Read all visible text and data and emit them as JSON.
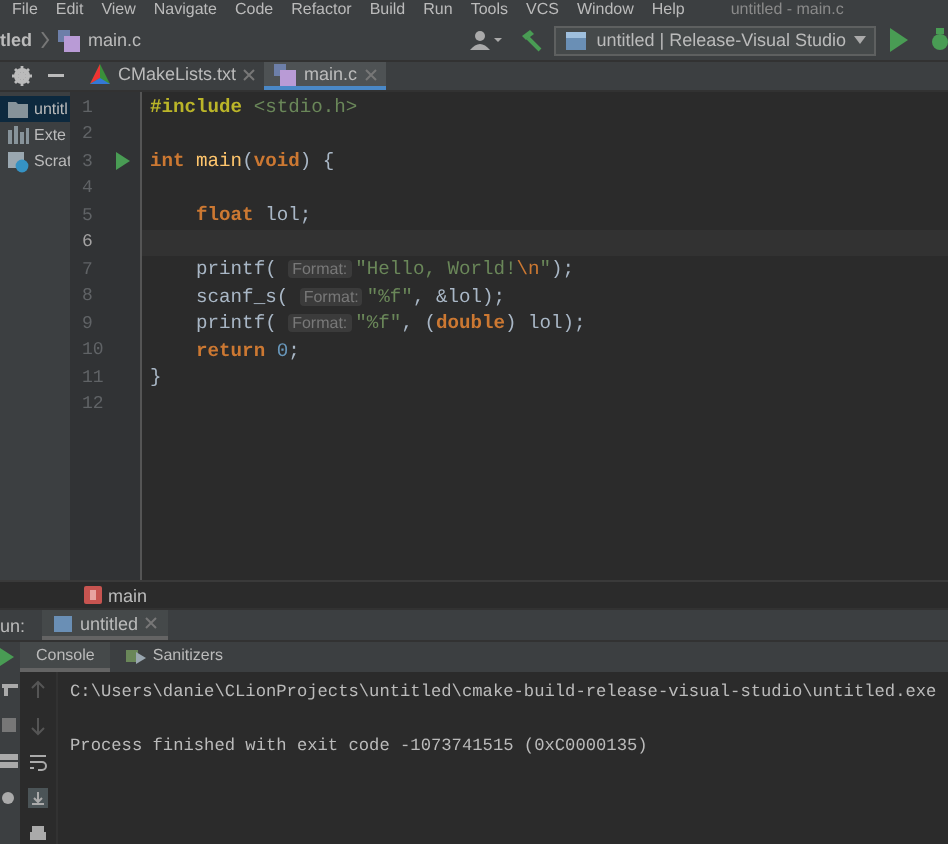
{
  "menu": [
    "File",
    "Edit",
    "View",
    "Navigate",
    "Code",
    "Refactor",
    "Build",
    "Run",
    "Tools",
    "VCS",
    "Window",
    "Help"
  ],
  "window_title": "untitled - main.c",
  "breadcrumbs": [
    "tled",
    "main.c"
  ],
  "run_config": "untitled | Release-Visual Studio",
  "editor_tabs": [
    {
      "label": "CMakeLists.txt",
      "kind": "cmake",
      "selected": false
    },
    {
      "label": "main.c",
      "kind": "c",
      "selected": true
    }
  ],
  "project_tree": [
    {
      "label": "untitl",
      "kind": "folder",
      "selected": true
    },
    {
      "label": "Exte",
      "kind": "library",
      "selected": false
    },
    {
      "label": "Scrat",
      "kind": "scratch",
      "selected": false
    }
  ],
  "code": [
    {
      "number": "1",
      "current": false,
      "run_marker": false,
      "tokens": [
        {
          "kind": "directive",
          "text": "#include"
        },
        {
          "kind": "header",
          "text": " <stdio.h>"
        }
      ]
    },
    {
      "number": "2",
      "current": false,
      "run_marker": false
    },
    {
      "number": "3",
      "current": false,
      "run_marker": true,
      "tokens": [
        {
          "kind": "keyword",
          "text": "int"
        },
        {
          "kind": "function",
          "text": " main"
        },
        {
          "kind": "plain",
          "text": "("
        },
        {
          "kind": "keyword",
          "text": "void"
        },
        {
          "kind": "plain",
          "text": ") {"
        }
      ]
    },
    {
      "number": "4",
      "current": false,
      "run_marker": false
    },
    {
      "number": "5",
      "current": false,
      "run_marker": false,
      "tokens": [
        {
          "kind": "keyword",
          "text": "    float"
        },
        {
          "kind": "plain",
          "text": " lol;"
        }
      ]
    },
    {
      "number": "6",
      "current": true,
      "run_marker": false
    },
    {
      "number": "7",
      "current": false,
      "run_marker": false,
      "tokens": [
        {
          "kind": "plain",
          "text": "    printf( "
        },
        {
          "kind": "hint",
          "text": "Format:"
        },
        {
          "kind": "string",
          "text": "\"Hello, World!"
        },
        {
          "kind": "escape",
          "text": "\\n"
        },
        {
          "kind": "string",
          "text": "\""
        },
        {
          "kind": "plain",
          "text": ");"
        }
      ]
    },
    {
      "number": "8",
      "current": false,
      "run_marker": false,
      "tokens": [
        {
          "kind": "plain",
          "text": "    scanf_s( "
        },
        {
          "kind": "hint",
          "text": "Format:"
        },
        {
          "kind": "string",
          "text": "\"%f\""
        },
        {
          "kind": "plain",
          "text": ", &lol);"
        }
      ]
    },
    {
      "number": "9",
      "current": false,
      "run_marker": false,
      "tokens": [
        {
          "kind": "plain",
          "text": "    printf( "
        },
        {
          "kind": "hint",
          "text": "Format:"
        },
        {
          "kind": "string",
          "text": "\"%f\""
        },
        {
          "kind": "plain",
          "text": ", ("
        },
        {
          "kind": "keyword",
          "text": "double"
        },
        {
          "kind": "plain",
          "text": ") lol);"
        }
      ]
    },
    {
      "number": "10",
      "current": false,
      "run_marker": false,
      "tokens": [
        {
          "kind": "keyword",
          "text": "    return"
        },
        {
          "kind": "number",
          "text": " 0"
        },
        {
          "kind": "plain",
          "text": ";"
        }
      ]
    },
    {
      "number": "11",
      "current": false,
      "run_marker": false,
      "tokens": [
        {
          "kind": "plain",
          "text": "}"
        }
      ]
    },
    {
      "number": "12",
      "current": false,
      "run_marker": false
    }
  ],
  "editor_breadcrumb": "main",
  "run_panel": {
    "label": "un:",
    "tabs": [
      {
        "label": "untitled",
        "selected": true
      }
    ]
  },
  "console_tabs": [
    {
      "label": "Console",
      "kind": "console",
      "selected": true
    },
    {
      "label": "Sanitizers",
      "kind": "sanitizers",
      "selected": false
    }
  ],
  "console_output": [
    "C:\\Users\\danie\\CLionProjects\\untitled\\cmake-build-release-visual-studio\\untitled.exe",
    "Process finished with exit code -1073741515 (0xC0000135)"
  ]
}
